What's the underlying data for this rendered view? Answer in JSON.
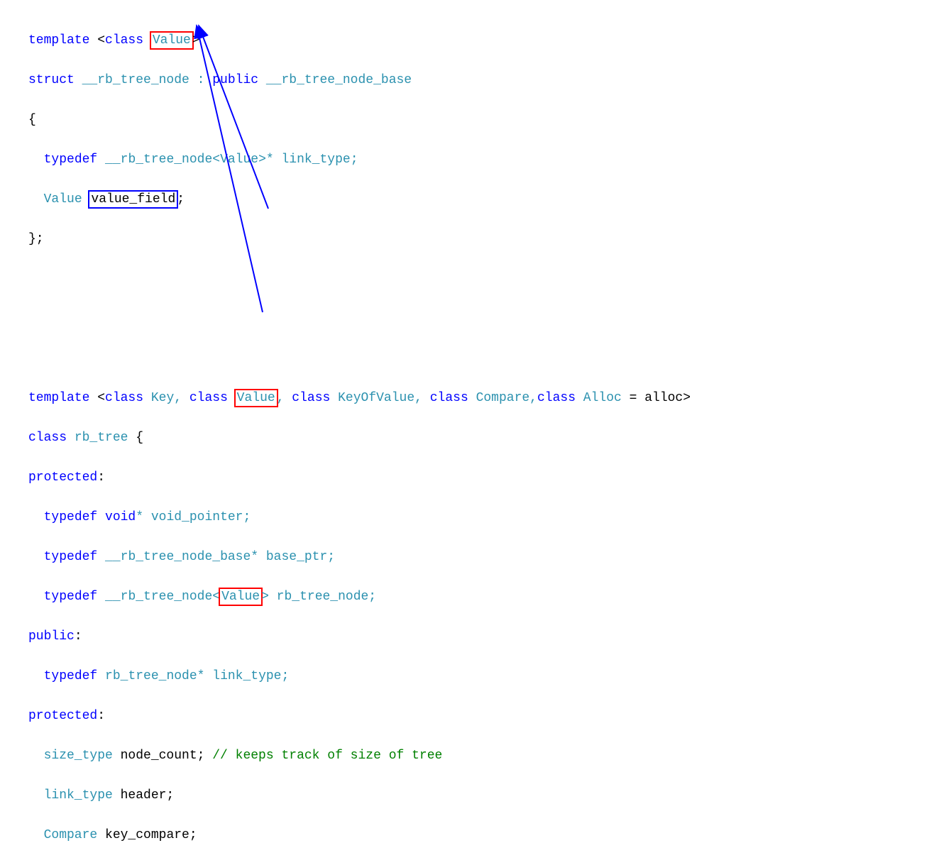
{
  "code": {
    "l1": {
      "a": "template ",
      "b": "<",
      "c": "class ",
      "d": "Value",
      "e": ">"
    },
    "l2": {
      "a": "struct",
      "b": " __rb_tree_node : ",
      "c": "public",
      "d": " __rb_tree_node_base"
    },
    "l3": {
      "a": "{"
    },
    "l4": {
      "a": "  ",
      "b": "typedef",
      "c": " __rb_tree_node<Value>* link_type;"
    },
    "l5": {
      "a": "  ",
      "b": "Value ",
      "c": "value_field",
      "d": ";"
    },
    "l6": {
      "a": "};"
    },
    "l7": {
      "a": "template ",
      "b": "<",
      "c": "class",
      "d": " Key, ",
      "e": "class ",
      "f": "Value",
      "g": ", ",
      "h": "class",
      "i": " KeyOfValue, ",
      "j": "class",
      "k": " Compare,",
      "l": "class",
      "m": " Alloc ",
      "n": "= alloc>"
    },
    "l8": {
      "a": "class",
      "b": " rb_tree ",
      "c": "{"
    },
    "l9": {
      "a": "protected",
      "b": ":"
    },
    "l10": {
      "a": "  ",
      "b": "typedef ",
      "c": "void",
      "d": "* void_pointer;"
    },
    "l11": {
      "a": "  ",
      "b": "typedef",
      "c": " __rb_tree_node_base* base_ptr;"
    },
    "l12": {
      "a": "  ",
      "b": "typedef",
      "c": " __rb_tree_node<",
      "d": "Value",
      "e": "> rb_tree_node;"
    },
    "l13": {
      "a": "public",
      "b": ":"
    },
    "l14": {
      "a": "  ",
      "b": "typedef",
      "c": " rb_tree_node* link_type;"
    },
    "l15": {
      "a": "protected",
      "b": ":"
    },
    "l16": {
      "a": "  size_type ",
      "b": "node_count; ",
      "c": "// keeps track of size of tree"
    },
    "l17": {
      "a": "  link_type ",
      "b": "header;"
    },
    "l18": {
      "a": "  Compare ",
      "b": "key_compare;"
    }
  }
}
